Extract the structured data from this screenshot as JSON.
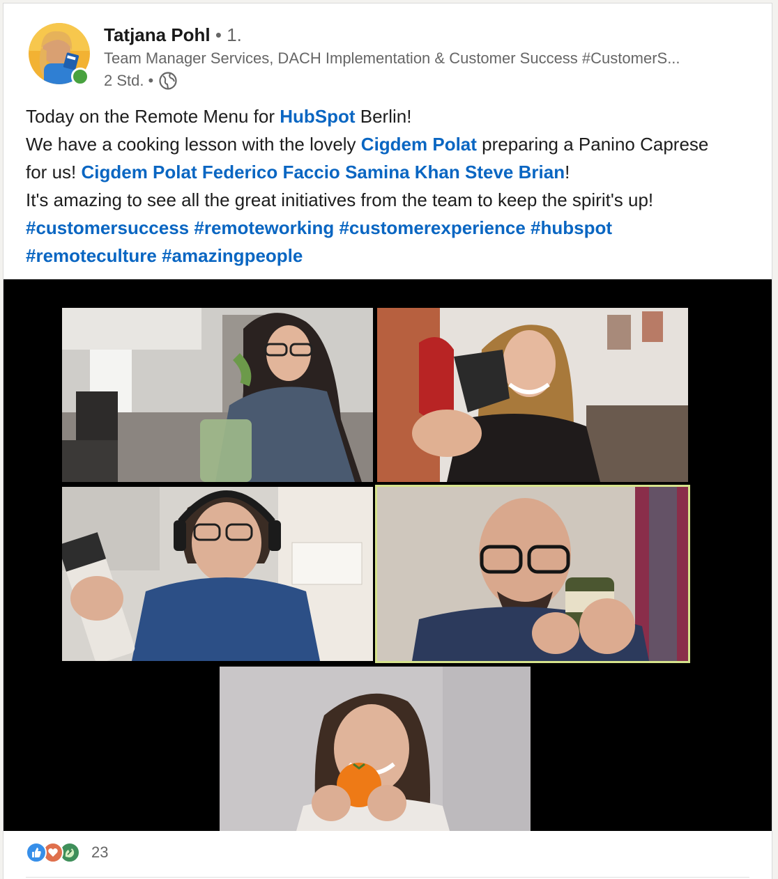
{
  "author": {
    "name": "Tatjana Pohl",
    "degree": "• 1.",
    "headline": "Team Manager Services, DACH Implementation & Customer Success #CustomerS...",
    "time": "2 Std.",
    "separator": "•",
    "visibility_icon": "globe-icon",
    "presence_color": "#48a23f"
  },
  "post": {
    "line1": {
      "prefix": "Today on the Remote Menu for ",
      "mention": "HubSpot",
      "suffix": " Berlin!"
    },
    "line2": {
      "prefix": "We have a cooking lesson with the lovely ",
      "mention": "Cigdem Polat",
      "suffix": " preparing a Panino Caprese"
    },
    "line3": {
      "prefix": "for us! ",
      "mentions": [
        "Cigdem Polat",
        "Federico Faccio",
        "Samina Khan",
        "Steve Brian"
      ],
      "suffix": "!"
    },
    "line4": "It's amazing to see all the great initiatives from the team to keep the spirit's up!",
    "hashtags_line1": [
      "#customersuccess",
      "#remoteworking",
      "#customerexperience",
      "#hubspot"
    ],
    "hashtags_line2": [
      "#remoteculture",
      "#amazingpeople"
    ],
    "link_color": "#0a66c2"
  },
  "media": {
    "background": "#000000",
    "active_speaker_border": "#d6e38c"
  },
  "reactions": {
    "icons": [
      "like-icon",
      "love-icon",
      "support-icon"
    ],
    "count": "23"
  }
}
